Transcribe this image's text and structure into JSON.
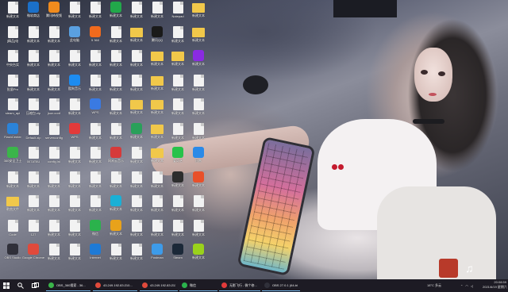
{
  "desktop_icons": [
    {
      "label": "新建文本",
      "type": "doc"
    },
    {
      "label": "[精品]电",
      "type": "doc"
    },
    {
      "label": "中央台实",
      "type": "doc"
    },
    {
      "label": "批量Pro",
      "type": "doc"
    },
    {
      "label": "steam_api",
      "type": "doc"
    },
    {
      "label": "FlashCenter",
      "type": "app",
      "color": "#2b83d9"
    },
    {
      "label": "360安全卫士",
      "type": "app",
      "color": "#3bb54a"
    },
    {
      "label": "新建文本",
      "type": "doc"
    },
    {
      "label": "歌曲文件",
      "type": "folder"
    },
    {
      "label": "Code",
      "type": "doc"
    },
    {
      "label": "OBS Studio",
      "type": "app",
      "color": "#30303a"
    },
    {
      "label": "微软商店",
      "type": "app",
      "color": "#1b70c9"
    },
    {
      "label": "新建文本",
      "type": "doc"
    },
    {
      "label": "新建文本",
      "type": "doc"
    },
    {
      "label": "新建文本",
      "type": "doc"
    },
    {
      "label": "压缩包.zip",
      "type": "doc"
    },
    {
      "label": "Default.zip",
      "type": "doc"
    },
    {
      "label": "007AT6U",
      "type": "doc"
    },
    {
      "label": "新建文本",
      "type": "doc"
    },
    {
      "label": "新建文本",
      "type": "doc"
    },
    {
      "label": "127",
      "type": "doc"
    },
    {
      "label": "Google Chrome",
      "type": "app",
      "color": "#e04a3b"
    },
    {
      "label": "腾讯柿视频",
      "type": "app",
      "color": "#f08b1d"
    },
    {
      "label": "新建文本",
      "type": "doc"
    },
    {
      "label": "新建文本",
      "type": "doc"
    },
    {
      "label": "新建文本",
      "type": "doc"
    },
    {
      "label": "json.conf",
      "type": "doc"
    },
    {
      "label": "serverconfig",
      "type": "doc"
    },
    {
      "label": "config.ini",
      "type": "doc"
    },
    {
      "label": "新建文本",
      "type": "doc"
    },
    {
      "label": "新建文本",
      "type": "doc"
    },
    {
      "label": "新建文本",
      "type": "doc"
    },
    {
      "label": "新建文本",
      "type": "doc"
    },
    {
      "label": "新建文本",
      "type": "doc"
    },
    {
      "label": "此电脑",
      "type": "app",
      "color": "#5aa0e0"
    },
    {
      "label": "新建文本",
      "type": "doc"
    },
    {
      "label": "酷狗音乐",
      "type": "app",
      "color": "#1d8cf0"
    },
    {
      "label": "新建文本",
      "type": "doc"
    },
    {
      "label": "WPS",
      "type": "app",
      "color": "#e23a3a"
    },
    {
      "label": "新建文本",
      "type": "doc"
    },
    {
      "label": "新建文本",
      "type": "doc"
    },
    {
      "label": "新建文本",
      "type": "doc"
    },
    {
      "label": "新建文本",
      "type": "doc"
    },
    {
      "label": "新建文本",
      "type": "doc"
    },
    {
      "label": "新建文本",
      "type": "doc"
    },
    {
      "label": "5 360",
      "type": "app",
      "color": "#f06a1d"
    },
    {
      "label": "新建文本",
      "type": "doc"
    },
    {
      "label": "新建文本",
      "type": "doc"
    },
    {
      "label": "WPS",
      "type": "app",
      "color": "#3a7ae2"
    },
    {
      "label": "新建文本",
      "type": "doc"
    },
    {
      "label": "新建文本",
      "type": "doc"
    },
    {
      "label": "新建文本",
      "type": "doc"
    },
    {
      "label": "新建文本",
      "type": "doc"
    },
    {
      "label": "微信",
      "type": "app",
      "color": "#2bb24c"
    },
    {
      "label": "Internet",
      "type": "app",
      "color": "#1e7ad6"
    },
    {
      "label": "新建文本",
      "type": "app",
      "color": "#22a84a"
    },
    {
      "label": "新建文本",
      "type": "doc"
    },
    {
      "label": "新建文本",
      "type": "doc"
    },
    {
      "label": "新建文本",
      "type": "doc"
    },
    {
      "label": "新建文本",
      "type": "doc"
    },
    {
      "label": "新建文本",
      "type": "doc"
    },
    {
      "label": "网易云音乐",
      "type": "app",
      "color": "#d63a3a"
    },
    {
      "label": "新建文本",
      "type": "doc"
    },
    {
      "label": "新建文本",
      "type": "app",
      "color": "#1ab0d6"
    },
    {
      "label": "新建文本",
      "type": "app",
      "color": "#e8a21b"
    },
    {
      "label": "新建文本",
      "type": "doc"
    },
    {
      "label": "新建文本",
      "type": "doc"
    },
    {
      "label": "新建文本",
      "type": "folder"
    },
    {
      "label": "新建文本",
      "type": "doc"
    },
    {
      "label": "新建文本",
      "type": "doc"
    },
    {
      "label": "新建文本",
      "type": "folder"
    },
    {
      "label": "新建文本",
      "type": "app",
      "color": "#2aa05a"
    },
    {
      "label": "新建文本",
      "type": "doc"
    },
    {
      "label": "新建文本",
      "type": "doc"
    },
    {
      "label": "新建文本",
      "type": "doc"
    },
    {
      "label": "新建文本",
      "type": "doc"
    },
    {
      "label": "新建文本",
      "type": "doc"
    },
    {
      "label": "新建文本",
      "type": "doc"
    },
    {
      "label": "腾讯QQ",
      "type": "app",
      "color": "#1a1a1a"
    },
    {
      "label": "新建文本",
      "type": "folder"
    },
    {
      "label": "新建文本",
      "type": "folder"
    },
    {
      "label": "新建文本",
      "type": "folder"
    },
    {
      "label": "新建文本",
      "type": "folder"
    },
    {
      "label": "新建文本",
      "type": "folder"
    },
    {
      "label": "新建文本",
      "type": "doc"
    },
    {
      "label": "新建文本",
      "type": "doc"
    },
    {
      "label": "新建文本",
      "type": "doc"
    },
    {
      "label": "Postman",
      "type": "app",
      "color": "#3d9be9"
    },
    {
      "label": "Notepad",
      "type": "doc"
    },
    {
      "label": "新建文本",
      "type": "doc"
    },
    {
      "label": "新建文本",
      "type": "folder"
    },
    {
      "label": "新建文本",
      "type": "doc"
    },
    {
      "label": "新建文本",
      "type": "doc"
    },
    {
      "label": "新建文本",
      "type": "doc"
    },
    {
      "label": "爱奇艺",
      "type": "app",
      "color": "#27c24a"
    },
    {
      "label": "新建文本",
      "type": "app",
      "color": "#2d2d2d"
    },
    {
      "label": "新建文本",
      "type": "doc"
    },
    {
      "label": "新建文本",
      "type": "doc"
    },
    {
      "label": "Steam",
      "type": "app",
      "color": "#1b2838"
    },
    {
      "label": "新建文本",
      "type": "folder"
    },
    {
      "label": "新建文本",
      "type": "folder"
    },
    {
      "label": "新建文本",
      "type": "app",
      "color": "#8a2be2"
    },
    {
      "label": "新建文本",
      "type": "doc"
    },
    {
      "label": "新建文本",
      "type": "doc"
    },
    {
      "label": "新建文本",
      "type": "doc"
    },
    {
      "label": "迅雷",
      "type": "app",
      "color": "#2a8ae8"
    },
    {
      "label": "新建文本",
      "type": "app",
      "color": "#e8502a"
    },
    {
      "label": "新建文本",
      "type": "doc"
    },
    {
      "label": "新建文本",
      "type": "doc"
    },
    {
      "label": "新建文本",
      "type": "app",
      "color": "#9ad21b"
    }
  ],
  "taskbar": {
    "search_icon": "search-icon",
    "buttons": [
      {
        "label": "OBS_360搜索 - 36...",
        "color": "#3bb54a"
      },
      {
        "label": "43.249.192.83:210...",
        "color": "#e04a3b"
      },
      {
        "label": "43.249.192.83:211...",
        "color": "#e04a3b"
      },
      {
        "label": "微信",
        "color": "#2bb24c"
      },
      {
        "label": "无影飞行 - 微个修...",
        "color": "#e23a3a"
      },
      {
        "label": "OBS 27.0.1 (64-bi...",
        "color": "#30303a"
      }
    ],
    "weather": "18°C 多云",
    "time": "20:08:59",
    "date": "2021/6/19 星期六"
  }
}
